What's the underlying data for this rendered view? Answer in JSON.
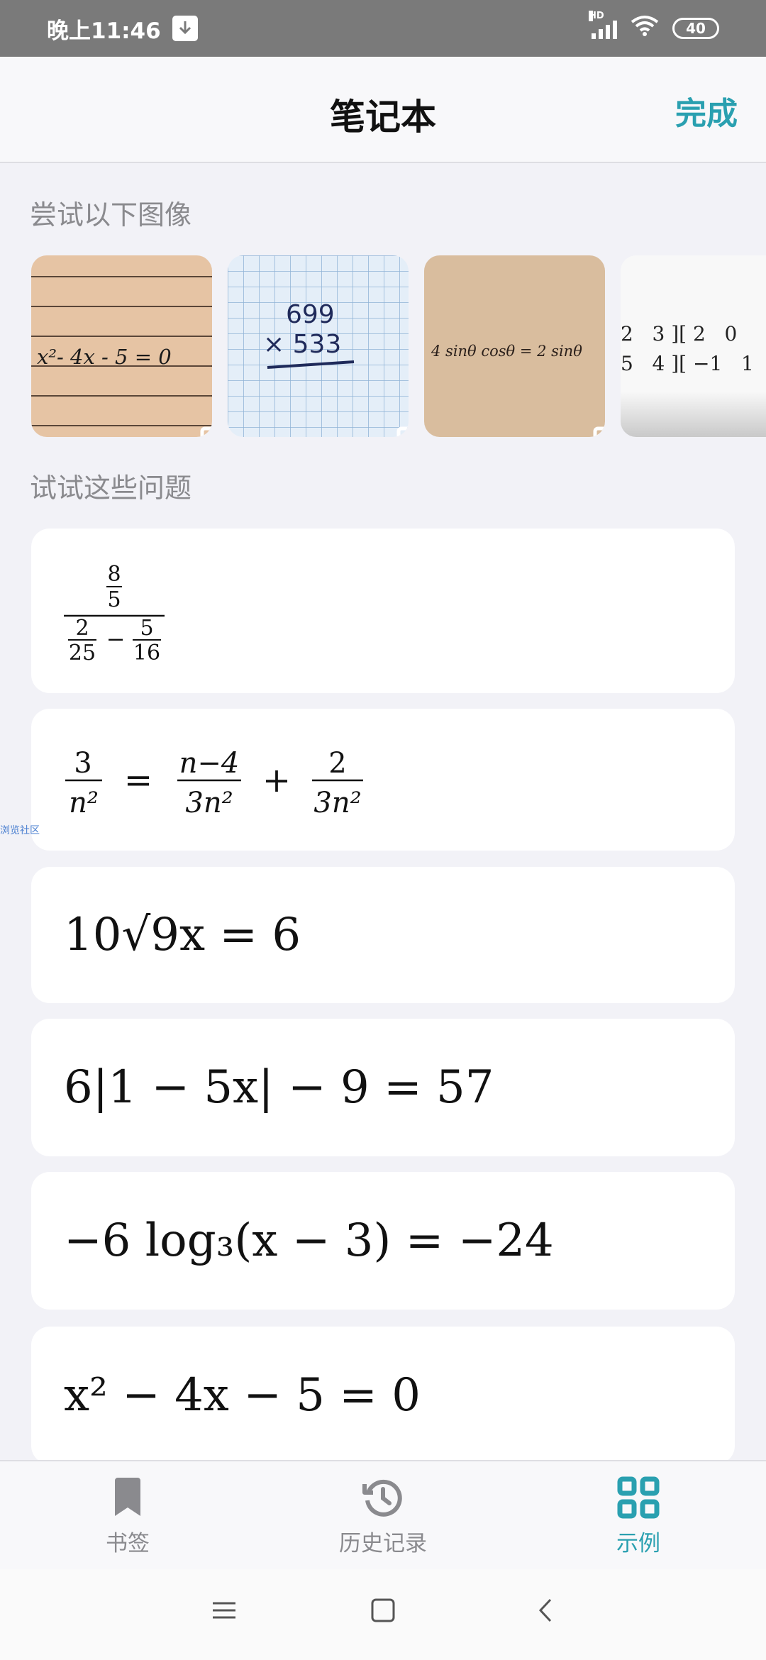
{
  "status_bar": {
    "time": "晚上11:46",
    "hd_label": "HD",
    "battery_level": "40",
    "icons": [
      "download-notification-icon",
      "signal-icon",
      "wifi-icon",
      "battery-icon"
    ]
  },
  "header": {
    "title": "笔记本",
    "done_label": "完成"
  },
  "images_section": {
    "label": "尝试以下图像",
    "thumbnails": [
      {
        "name": "thumb-quadratic",
        "handwriting": "x²- 4x - 5 = 0"
      },
      {
        "name": "thumb-multiplication",
        "handwriting_top": "699",
        "handwriting_bottom": "× 533"
      },
      {
        "name": "thumb-trig",
        "handwriting": "4 sinθ cosθ = 2 sinθ"
      },
      {
        "name": "thumb-matrix",
        "row1": "2   3 ][ 2   0",
        "row2": "5   4 ][ −1   1"
      }
    ]
  },
  "problems_section": {
    "label": "试试这些问题",
    "problems": [
      {
        "numer_top": "8",
        "numer_bottom": "5",
        "a_top": "2",
        "a_bottom": "25",
        "minus": "−",
        "b_top": "5",
        "b_bottom": "16"
      },
      {
        "l_top": "3",
        "l_bottom": "n²",
        "eq": "=",
        "m_top": "n−4",
        "m_bottom": "3n²",
        "plus": "+",
        "r_top": "2",
        "r_bottom": "3n²"
      },
      {
        "text": "10√9x = 6"
      },
      {
        "text": "6|1 − 5x| − 9 = 57"
      },
      {
        "text": "−6 log₃(x − 3) = −24"
      },
      {
        "text": "x² − 4x − 5 = 0"
      }
    ]
  },
  "tab_bar": {
    "tabs": [
      {
        "label": "书签",
        "icon": "bookmark-icon",
        "active": false
      },
      {
        "label": "历史记录",
        "icon": "history-icon",
        "active": false
      },
      {
        "label": "示例",
        "icon": "grid-icon",
        "active": true
      }
    ]
  },
  "side_watermark": "浏览社区",
  "colors": {
    "accent": "#2aa0b0",
    "status_bar": "#7a7a7a",
    "background": "#f2f2f7",
    "inactive": "#8a8a8e"
  }
}
